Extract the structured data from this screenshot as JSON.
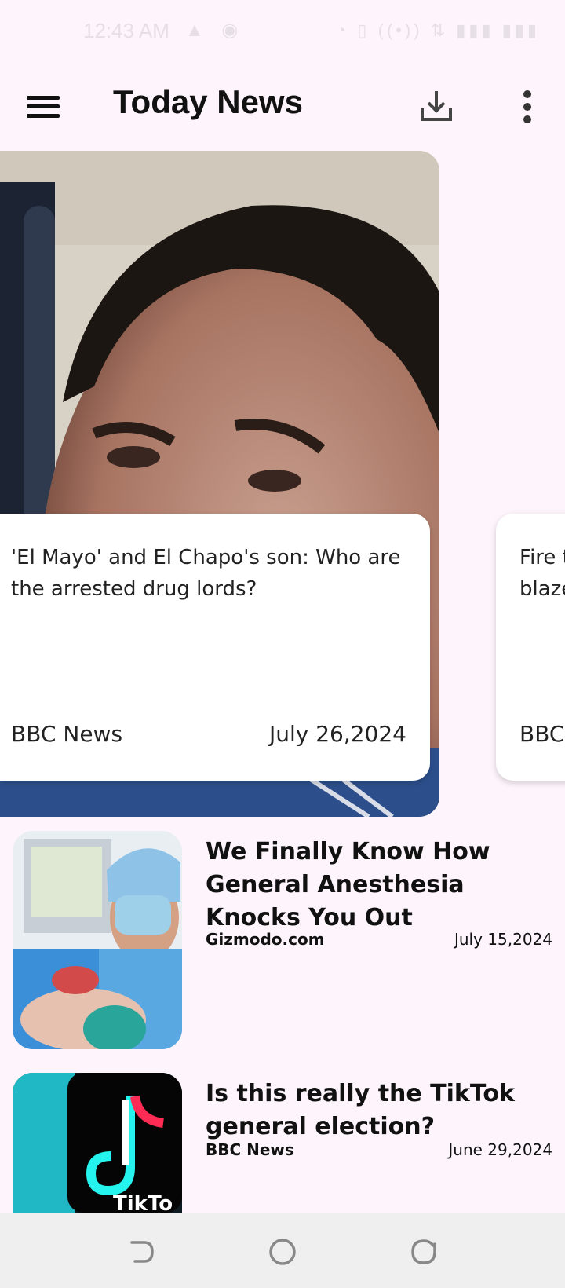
{
  "status_bar": {
    "time": "12:43 AM",
    "icons": [
      "alarm-icon",
      "vibrate-icon",
      "hotspot-icon",
      "wifi-icon",
      "signal-icon",
      "battery-icon"
    ],
    "battery": "61"
  },
  "app_bar": {
    "title": "Today News"
  },
  "carousel": {
    "cards": [
      {
        "title": "'El Mayo' and El Chapo's son: Who are the arrested drug lords?",
        "source": "BBC News",
        "date": "July 26,2024"
      },
      {
        "title": "Fire t... blaze...",
        "title_visible": "Fire t\nblaze",
        "source": "BBC"
      }
    ]
  },
  "articles": [
    {
      "title": "We Finally Know How General Anesthesia Knocks You Out",
      "source": "Gizmodo.com",
      "date": "July 15,2024"
    },
    {
      "title": "Is this really the TikTok general election?",
      "source": "BBC News",
      "date": "June 29,2024"
    }
  ],
  "colors": {
    "background": "#fdf5fb",
    "nav_bar": "#efefef",
    "card": "#ffffff"
  }
}
